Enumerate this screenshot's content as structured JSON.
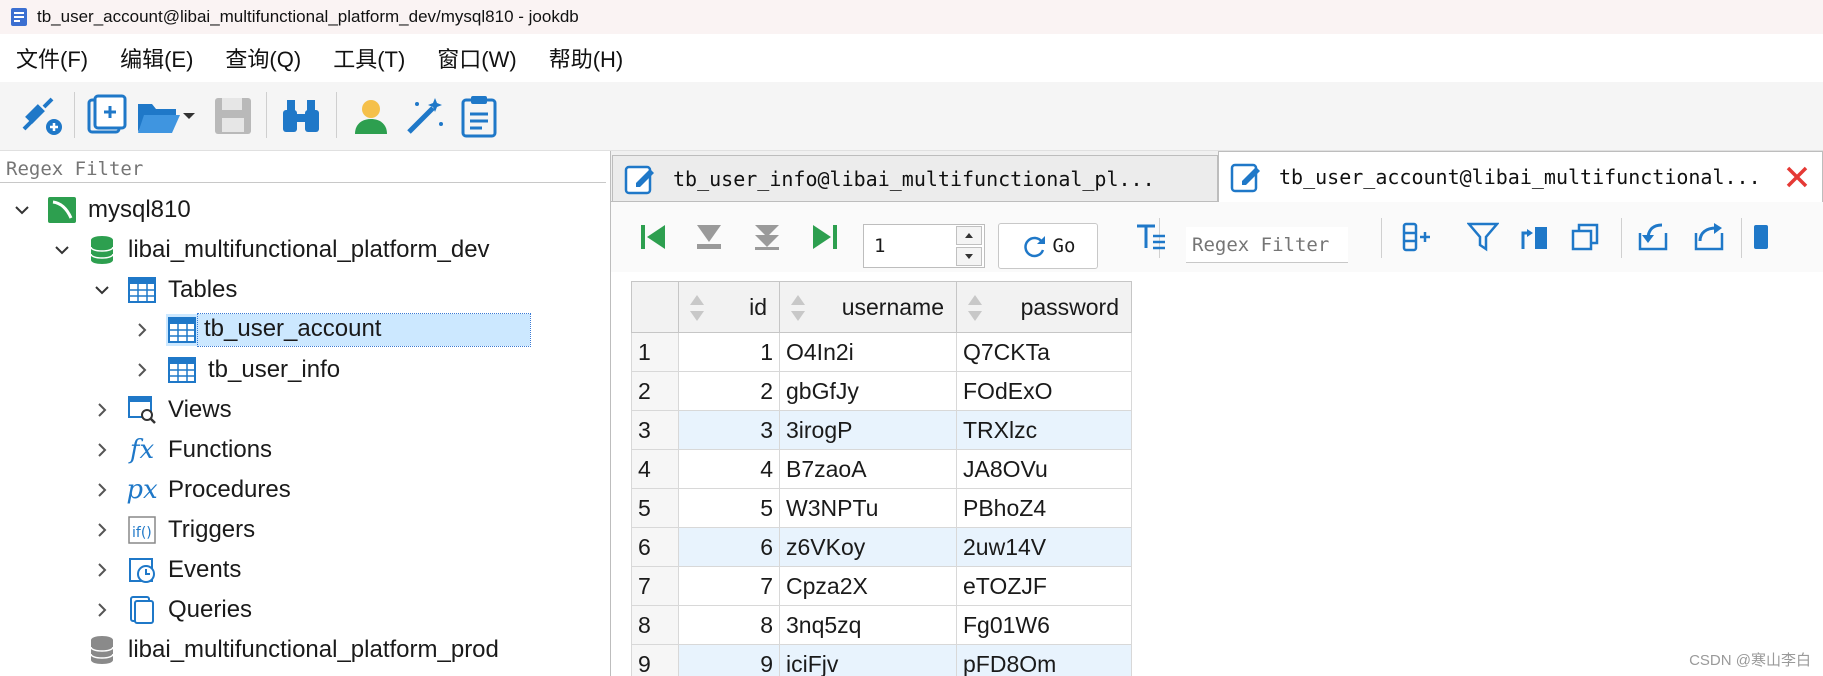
{
  "window": {
    "title": "tb_user_account@libai_multifunctional_platform_dev/mysql810 - jookdb"
  },
  "menu": [
    "文件(F)",
    "编辑(E)",
    "查询(Q)",
    "工具(T)",
    "窗口(W)",
    "帮助(H)"
  ],
  "toolbar_icons": [
    "connect-icon",
    "new-query-icon",
    "open-folder-icon",
    "save-icon",
    "binoculars-icon",
    "user-icon",
    "magic-wand-icon",
    "clipboard-icon"
  ],
  "left": {
    "filter_placeholder": "Regex Filter",
    "tree": {
      "connection": "mysql810",
      "database_dev": "libai_multifunctional_platform_dev",
      "tables": "Tables",
      "table1": "tb_user_account",
      "table2": "tb_user_info",
      "views": "Views",
      "functions": "Functions",
      "procedures": "Procedures",
      "triggers": "Triggers",
      "events": "Events",
      "queries": "Queries",
      "database_prod": "libai_multifunctional_platform_prod"
    }
  },
  "tabs": [
    {
      "label": "tb_user_info@libai_multifunctional_pl..."
    },
    {
      "label": "tb_user_account@libai_multifunctional..."
    }
  ],
  "grid": {
    "page_value": "1",
    "go_label": "Go",
    "filter_placeholder": "Regex Filter",
    "columns": [
      "id",
      "username",
      "password"
    ],
    "rows": [
      {
        "rn": "1",
        "id": "1",
        "username": "O4In2i",
        "password": "Q7CKTa"
      },
      {
        "rn": "2",
        "id": "2",
        "username": "gbGfJy",
        "password": "FOdExO"
      },
      {
        "rn": "3",
        "id": "3",
        "username": "3irogP",
        "password": "TRXlzc"
      },
      {
        "rn": "4",
        "id": "4",
        "username": "B7zaoA",
        "password": "JA8OVu"
      },
      {
        "rn": "5",
        "id": "5",
        "username": "W3NPTu",
        "password": "PBhoZ4"
      },
      {
        "rn": "6",
        "id": "6",
        "username": "z6VKoy",
        "password": "2uw14V"
      },
      {
        "rn": "7",
        "id": "7",
        "username": "Cpza2X",
        "password": "eTOZJF"
      },
      {
        "rn": "8",
        "id": "8",
        "username": "3nq5zq",
        "password": "Fg01W6"
      },
      {
        "rn": "9",
        "id": "9",
        "username": "iciFjv",
        "password": "pFD8Om"
      }
    ]
  },
  "watermark": "CSDN @寒山李白",
  "colors": {
    "accent": "#2d9f4f",
    "icon_blue": "#1f78c8",
    "selection": "#cce8ff",
    "row_alt": "#e8f3fd",
    "close_red": "#e53935"
  }
}
